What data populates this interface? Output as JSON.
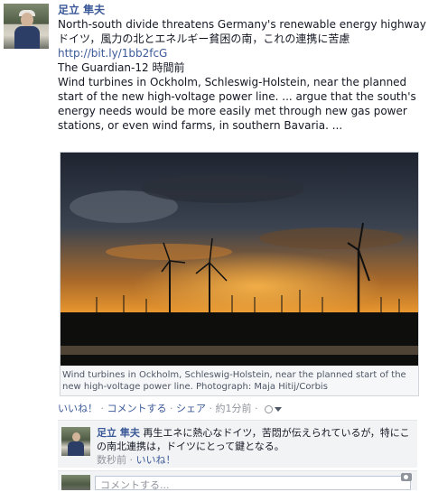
{
  "post": {
    "author": "足立 隼夫",
    "title_en": "North-south divide threatens Germany's renewable energy highway",
    "title_ja": "ドイツ，風力の北とエネルギー貧困の南，これの連携に苦慮",
    "link": "http://bit.ly/1bb2fcG",
    "source": "The Guardian-12 時間前",
    "excerpt": "Wind turbines in Ockholm, Schleswig-Holstein, near the planned start of the new high-voltage power line. ... argue that the south's energy needs would be more easily met through new gas power stations, or even wind farms, in southern Bavaria. ...",
    "photo_caption": "Wind turbines in Ockholm, Schleswig-Holstein, near the planned start of the new high-voltage power line. Photograph: Maja Hitij/Corbis"
  },
  "actions": {
    "like": "いいね！",
    "sep1": "·",
    "comment": "コメントする",
    "sep2": "·",
    "share": "シェア",
    "sep3": "·",
    "time": "約1分前",
    "sep4": "·"
  },
  "comment": {
    "author": "足立 隼夫",
    "text": "再生エネに熱心なドイツ，苦悶が伝えられているが，特にこの南北連携は，ドイツにとって鍵となる。",
    "time": "数秒前",
    "sep": "·",
    "like": "いいね！"
  },
  "compose": {
    "placeholder": "コメントする..."
  },
  "colors": {
    "link": "#3b5998",
    "muted": "#90949c",
    "comment_bg": "#f2f3f5"
  }
}
